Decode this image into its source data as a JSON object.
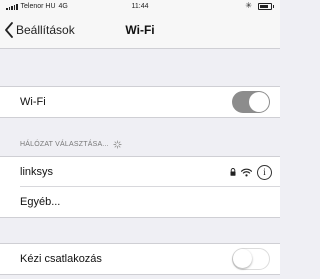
{
  "status_bar": {
    "carrier": "Telenor HU",
    "network": "4G",
    "time": "11:44"
  },
  "nav_bar": {
    "back_label": "Beállítások",
    "title": "Wi-Fi"
  },
  "wifi_row": {
    "label": "Wi-Fi",
    "toggle_on": true
  },
  "network_section": {
    "header": "HÁLÓZAT VÁLASZTÁSA...",
    "networks": [
      {
        "name": "linksys",
        "secured": true,
        "icon": "wifi-icon"
      }
    ],
    "other_label": "Egyéb..."
  },
  "ask_to_join": {
    "label": "Kézi csatlakozás",
    "toggle_on": false
  }
}
